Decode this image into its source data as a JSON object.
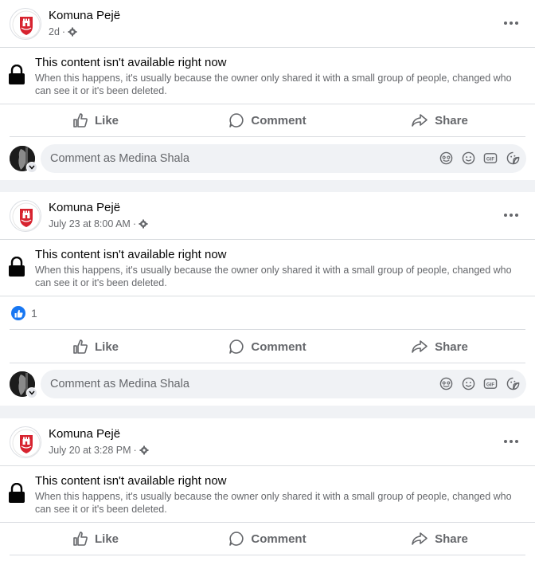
{
  "posts": [
    {
      "page_name": "Komuna Pejë",
      "time": "2d",
      "unavailable_title": "This content isn't available right now",
      "unavailable_text": "When this happens, it's usually because the owner only shared it with a small group of people, changed who can see it or it's been deleted.",
      "like_count": null,
      "actions": {
        "like": "Like",
        "comment": "Comment",
        "share": "Share"
      },
      "comment_placeholder": "Comment as Medina Shala"
    },
    {
      "page_name": "Komuna Pejë",
      "time": "July 23 at 8:00 AM",
      "unavailable_title": "This content isn't available right now",
      "unavailable_text": "When this happens, it's usually because the owner only shared it with a small group of people, changed who can see it or it's been deleted.",
      "like_count": "1",
      "actions": {
        "like": "Like",
        "comment": "Comment",
        "share": "Share"
      },
      "comment_placeholder": "Comment as Medina Shala"
    },
    {
      "page_name": "Komuna Pejë",
      "time": "July 20 at 3:28 PM",
      "unavailable_title": "This content isn't available right now",
      "unavailable_text": "When this happens, it's usually because the owner only shared it with a small group of people, changed who can see it or it's been deleted.",
      "like_count": null,
      "actions": {
        "like": "Like",
        "comment": "Comment",
        "share": "Share"
      },
      "comment_placeholder": null
    }
  ],
  "separator": "·",
  "colors": {
    "accent": "#1877f2",
    "secondary_text": "#65676b",
    "crest_red": "#d7232f"
  },
  "icons": [
    "crest-logo",
    "gear-icon",
    "more-icon",
    "lock-icon",
    "like-icon",
    "comment-icon",
    "share-icon",
    "avatar-emoji-icon",
    "emoji-icon",
    "gif-icon",
    "sticker-icon"
  ]
}
